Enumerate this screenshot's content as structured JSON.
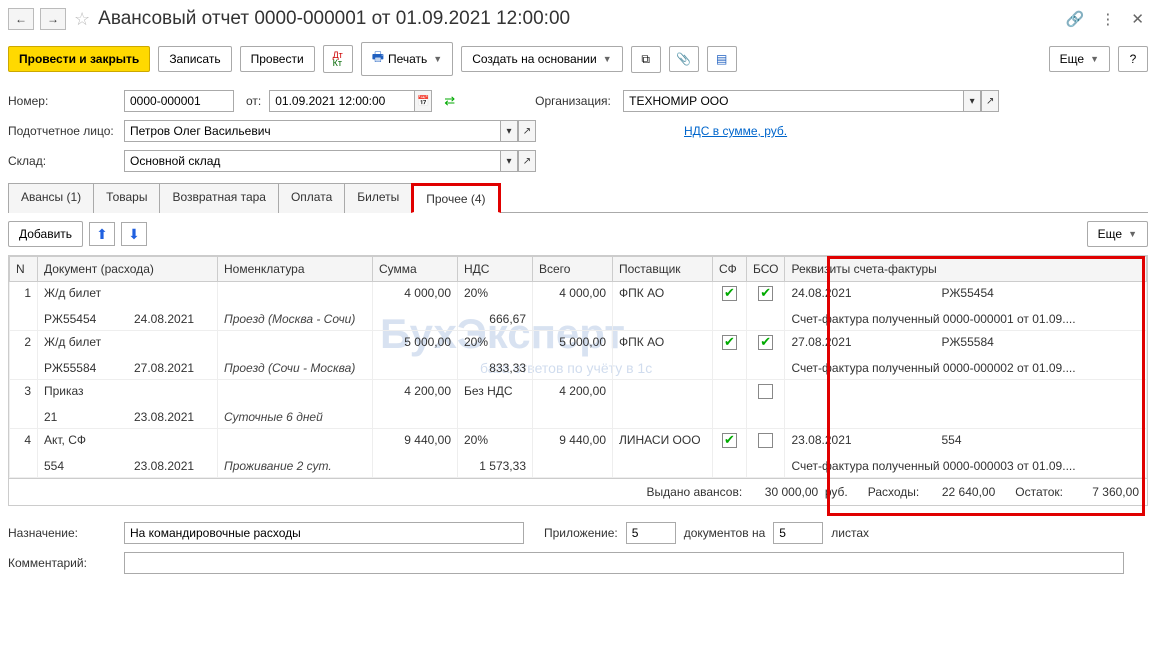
{
  "title": "Авансовый отчет 0000-000001 от 01.09.2021 12:00:00",
  "toolbar": {
    "post_close": "Провести и закрыть",
    "save": "Записать",
    "post": "Провести",
    "print": "Печать",
    "create_based": "Создать на основании",
    "more": "Еще"
  },
  "fields": {
    "number_label": "Номер:",
    "number": "0000-000001",
    "from_label": "от:",
    "date": "01.09.2021 12:00:00",
    "org_label": "Организация:",
    "org": "ТЕХНОМИР ООО",
    "person_label": "Подотчетное лицо:",
    "person": "Петров Олег Васильевич",
    "vat_link": "НДС в сумме, руб.",
    "warehouse_label": "Склад:",
    "warehouse": "Основной склад"
  },
  "tabs": {
    "advances": "Авансы (1)",
    "goods": "Товары",
    "returnable": "Возвратная тара",
    "payment": "Оплата",
    "tickets": "Билеты",
    "other": "Прочее (4)"
  },
  "subtoolbar": {
    "add": "Добавить",
    "more": "Еще"
  },
  "headers": {
    "n": "N",
    "doc": "Документ (расхода)",
    "nomen": "Номенклатура",
    "sum": "Сумма",
    "vat": "НДС",
    "total": "Всего",
    "supplier": "Поставщик",
    "sf": "СФ",
    "bso": "БСО",
    "req": "Реквизиты счета-фактуры"
  },
  "rows": [
    {
      "n": "1",
      "doc1": "Ж/д билет",
      "doc2a": "РЖ55454",
      "doc2b": "24.08.2021",
      "nomen": "Проезд (Москва - Сочи)",
      "sum": "4 000,00",
      "vat_rate": "20%",
      "vat_sum": "666,67",
      "total": "4 000,00",
      "supplier": "ФПК АО",
      "sf": true,
      "bso": true,
      "req1a": "24.08.2021",
      "req1b": "РЖ55454",
      "req2": "Счет-фактура полученный 0000-000001 от 01.09...."
    },
    {
      "n": "2",
      "doc1": "Ж/д билет",
      "doc2a": "РЖ55584",
      "doc2b": "27.08.2021",
      "nomen": "Проезд (Сочи - Москва)",
      "sum": "5 000,00",
      "vat_rate": "20%",
      "vat_sum": "833,33",
      "total": "5 000,00",
      "supplier": "ФПК АО",
      "sf": true,
      "bso": true,
      "req1a": "27.08.2021",
      "req1b": "РЖ55584",
      "req2": "Счет-фактура полученный 0000-000002 от 01.09...."
    },
    {
      "n": "3",
      "doc1": "Приказ",
      "doc2a": "21",
      "doc2b": "23.08.2021",
      "nomen": "Суточные 6 дней",
      "sum": "4 200,00",
      "vat_rate": "Без НДС",
      "vat_sum": "",
      "total": "4 200,00",
      "supplier": "",
      "sf": false,
      "bso": false,
      "bso_show": true,
      "req1a": "",
      "req1b": "",
      "req2": ""
    },
    {
      "n": "4",
      "doc1": "Акт, СФ",
      "doc2a": "554",
      "doc2b": "23.08.2021",
      "nomen": "Проживание 2 сут.",
      "sum": "9 440,00",
      "vat_rate": "20%",
      "vat_sum": "1 573,33",
      "total": "9 440,00",
      "supplier": "ЛИНАСИ ООО",
      "sf": true,
      "bso": false,
      "bso_show": true,
      "req1a": "23.08.2021",
      "req1b": "554",
      "req2": "Счет-фактура полученный 0000-000003 от 01.09...."
    }
  ],
  "totals": {
    "advances_label": "Выдано авансов:",
    "advances": "30 000,00",
    "currency": "руб.",
    "expenses_label": "Расходы:",
    "expenses": "22 640,00",
    "balance_label": "Остаток:",
    "balance": "7 360,00"
  },
  "footer": {
    "purpose_label": "Назначение:",
    "purpose": "На командировочные расходы",
    "attachment_label": "Приложение:",
    "att_docs": "5",
    "docs_on": "документов на",
    "att_sheets": "5",
    "sheets": "листах",
    "comment_label": "Комментарий:"
  },
  "watermark": "БухЭксперт",
  "watermark2": "база ответов по учёту в 1с"
}
